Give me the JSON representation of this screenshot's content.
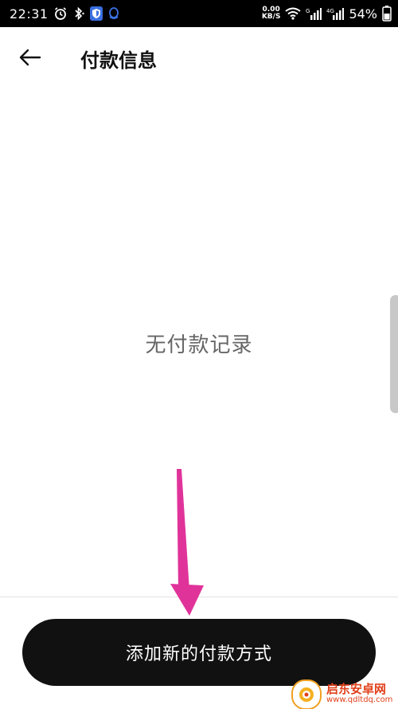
{
  "status_bar": {
    "time": "22:31",
    "net_speed_value": "0.00",
    "net_speed_unit": "KB/S",
    "battery": "54%",
    "icons": [
      "alarm-icon",
      "bluetooth-icon",
      "shield-icon",
      "qq-icon",
      "wifi-icon",
      "signal-icon",
      "signal-4g-icon",
      "battery-icon"
    ]
  },
  "header": {
    "title": "付款信息",
    "back_icon": "arrow-left-icon"
  },
  "main": {
    "empty_message": "无付款记录"
  },
  "footer": {
    "add_button_label": "添加新的付款方式"
  },
  "watermark": {
    "title": "启东安卓网",
    "url": "www.qdltdq.com"
  },
  "colors": {
    "status_bar_bg": "#000000",
    "button_bg": "#111111",
    "annotation_arrow": "#e0339a",
    "empty_text": "#666666"
  }
}
